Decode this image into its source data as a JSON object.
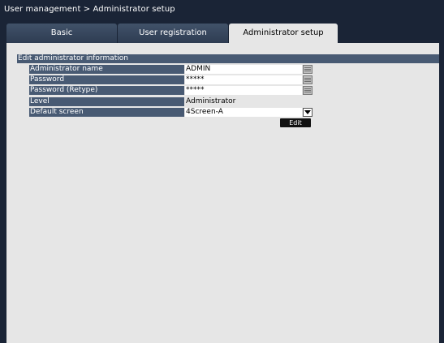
{
  "breadcrumb": "User management > Administrator setup",
  "tabs": {
    "basic": "Basic",
    "user_registration": "User registration",
    "administrator_setup": "Administrator setup",
    "active": "administrator_setup"
  },
  "section": {
    "title": "Edit administrator information"
  },
  "fields": {
    "administrator_name": {
      "label": "Administrator name",
      "value": "ADMIN"
    },
    "password": {
      "label": "Password",
      "value": "*****"
    },
    "password_retype": {
      "label": "Password (Retype)",
      "value": "*****"
    },
    "level": {
      "label": "Level",
      "value": "Administrator"
    },
    "default_screen": {
      "label": "Default screen",
      "value": "4Screen-A"
    }
  },
  "edit_button": "Edit",
  "colors": {
    "background": "#1a2436",
    "panel": "#e6e6e6",
    "label_bar": "#485a73",
    "tab_inactive": "#3a4a60"
  },
  "icons": {
    "keyboard": "keyboard-icon",
    "dropdown": "triangle-down-icon"
  }
}
